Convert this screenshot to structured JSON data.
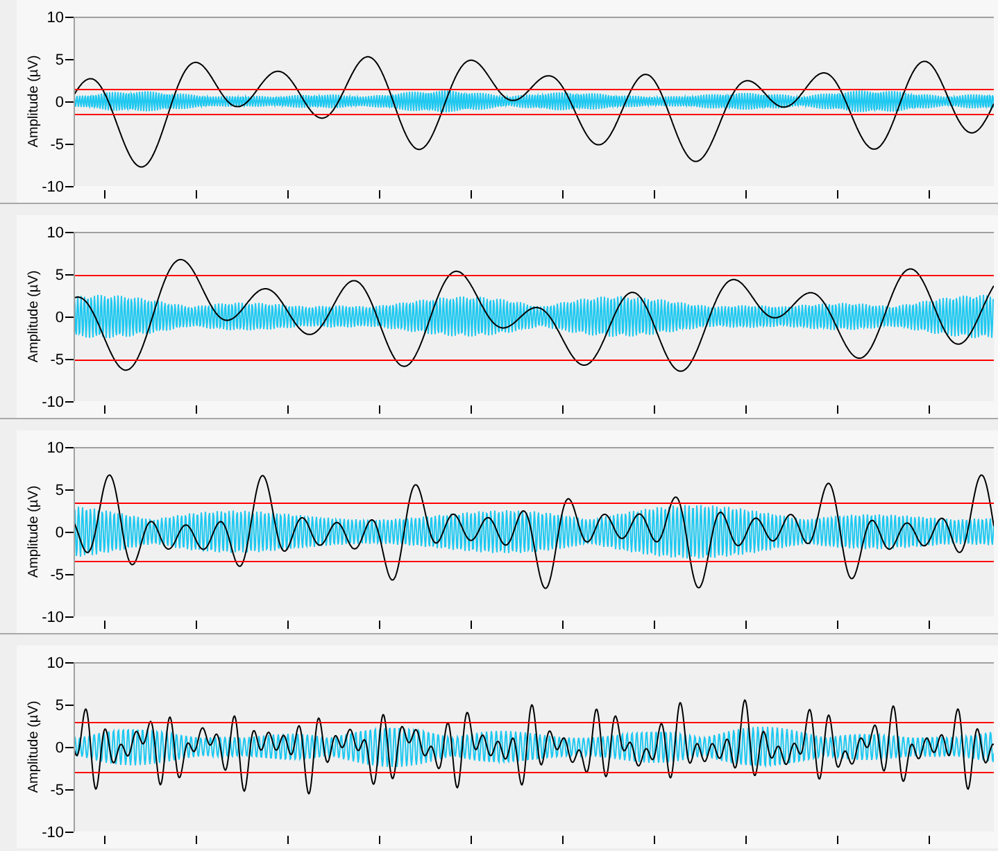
{
  "panels": [
    {
      "y_axis": {
        "label": "Amplitude (µV)",
        "ticks": [
          "10",
          "5",
          "0",
          "-5",
          "-10"
        ]
      }
    },
    {
      "y_axis": {
        "label": "Amplitude (µV)",
        "ticks": [
          "10",
          "5",
          "0",
          "-5",
          "-10"
        ]
      }
    },
    {
      "y_axis": {
        "label": "Amplitude (µV)",
        "ticks": [
          "10",
          "5",
          "0",
          "-5",
          "-10"
        ]
      }
    },
    {
      "y_axis": {
        "label": "Amplitude (µV)",
        "ticks": [
          "10",
          "5",
          "0",
          "-5",
          "-10"
        ]
      }
    }
  ]
}
